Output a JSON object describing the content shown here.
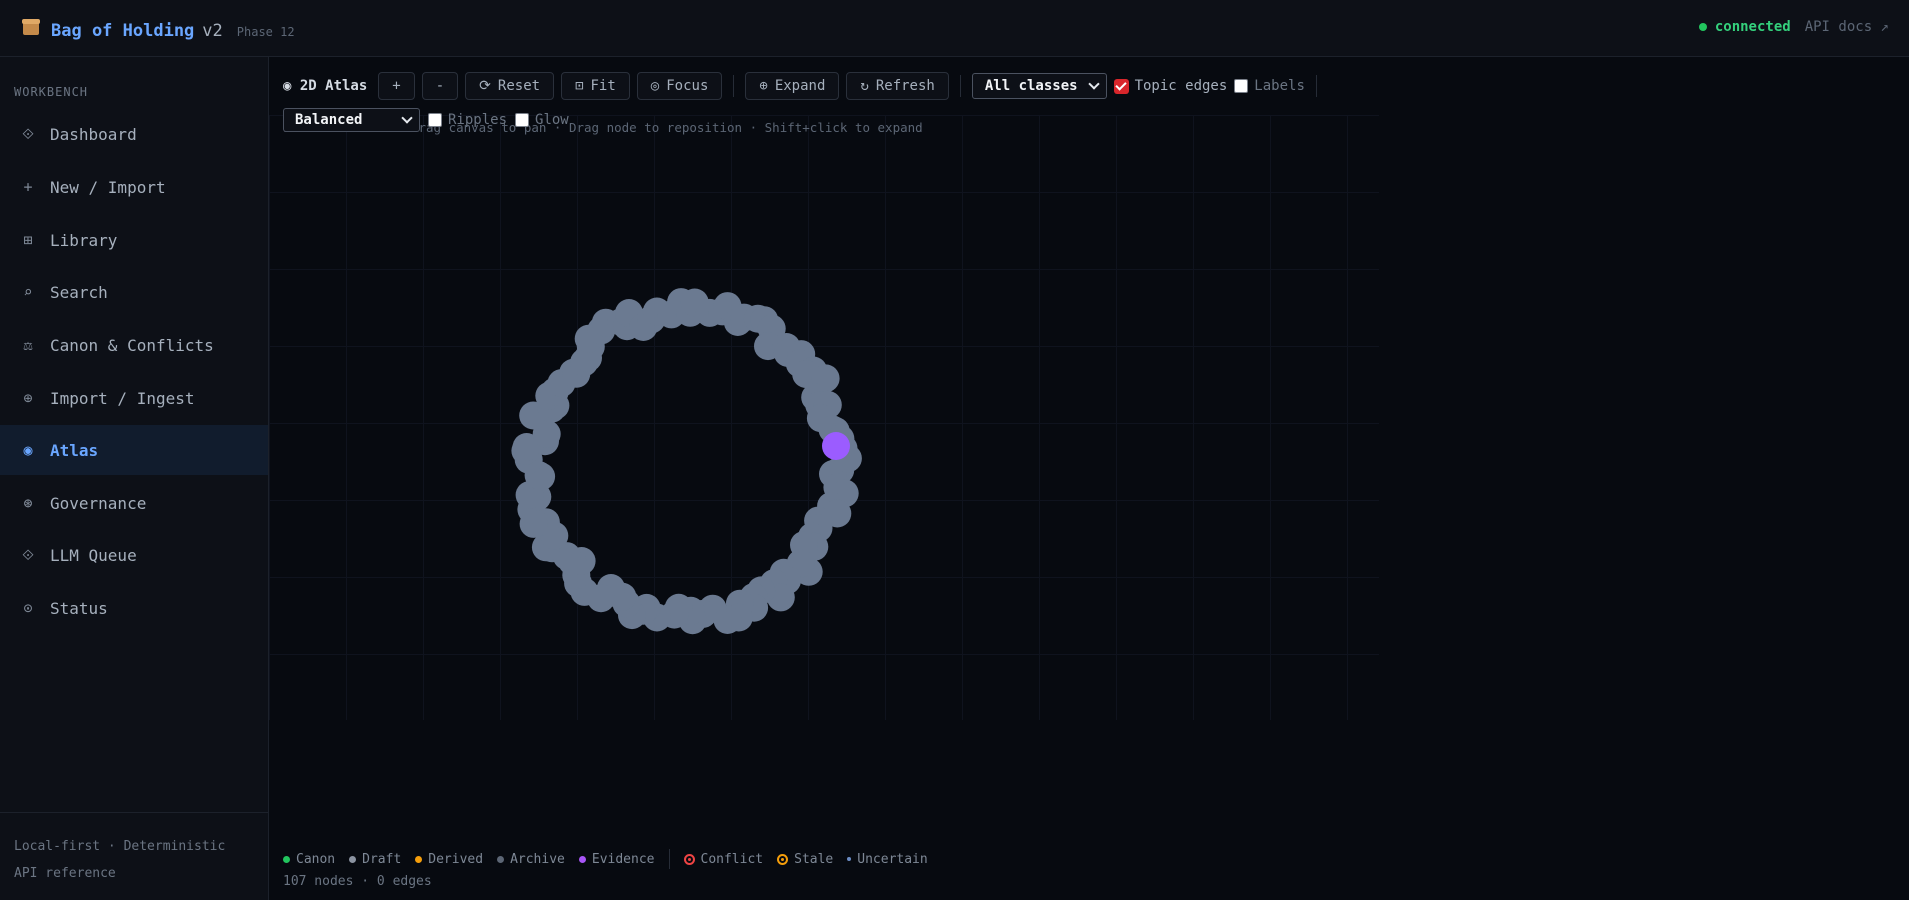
{
  "header": {
    "app_name": "Bag of Holding",
    "version": "v2",
    "phase": "Phase 12",
    "status_text": "connected",
    "api_docs_link": "API docs ↗"
  },
  "sidebar": {
    "heading": "WORKBENCH",
    "items": [
      {
        "label": "Dashboard",
        "icon": "diamond-icon",
        "glyph": "⟐"
      },
      {
        "label": "New / Import",
        "icon": "plus-icon",
        "glyph": "+"
      },
      {
        "label": "Library",
        "icon": "grid-icon",
        "glyph": "⊞"
      },
      {
        "label": "Search",
        "icon": "search-icon",
        "glyph": "⌕"
      },
      {
        "label": "Canon & Conflicts",
        "icon": "scales-icon",
        "glyph": "⚖"
      },
      {
        "label": "Import / Ingest",
        "icon": "globe-icon",
        "glyph": "⊕"
      },
      {
        "label": "Atlas",
        "icon": "target-icon",
        "glyph": "◉"
      },
      {
        "label": "Governance",
        "icon": "shield-icon",
        "glyph": "⊛"
      },
      {
        "label": "LLM Queue",
        "icon": "queue-icon",
        "glyph": "⟐"
      },
      {
        "label": "Status",
        "icon": "status-icon",
        "glyph": "⊙"
      }
    ],
    "active": "Atlas",
    "footer_tagline": "Local-first · Deterministic",
    "footer_link": "API reference"
  },
  "toolbar": {
    "view_label": "◉ 2D Atlas",
    "zoom_in": "+",
    "zoom_out": "-",
    "reset": "Reset",
    "fit": "Fit",
    "focus": "Focus",
    "expand": "Expand",
    "refresh": "Refresh",
    "class_filter": "All classes",
    "topic_edges_label": "Topic edges",
    "topic_edges_checked": true,
    "labels_label": "Labels",
    "labels_checked": false,
    "layout_mode": "Balanced",
    "ripples_label": "Ripples",
    "ripples_checked": false,
    "glow_label": "Glow",
    "glow_checked": false
  },
  "hint": "Scroll to zoom · Drag canvas to pan · Drag node to reposition · Shift+click to expand",
  "legend": {
    "dots": [
      {
        "label": "Canon",
        "color": "#22c55e"
      },
      {
        "label": "Draft",
        "color": "#8b93a1"
      },
      {
        "label": "Derived",
        "color": "#f59e0b"
      },
      {
        "label": "Archive",
        "color": "#5c6675"
      },
      {
        "label": "Evidence",
        "color": "#a855f7"
      }
    ],
    "rings": [
      {
        "label": "Conflict",
        "color": "#ef4444"
      },
      {
        "label": "Stale",
        "color": "#f59e0b"
      },
      {
        "label": "Uncertain",
        "color": "#6b8cc4"
      }
    ]
  },
  "counts": "107 nodes · 0 edges",
  "colors": {
    "accent": "#6aa6ff",
    "node": "#6b7a91",
    "evidence_node": "#9b5cff",
    "connected": "#22c55e"
  }
}
